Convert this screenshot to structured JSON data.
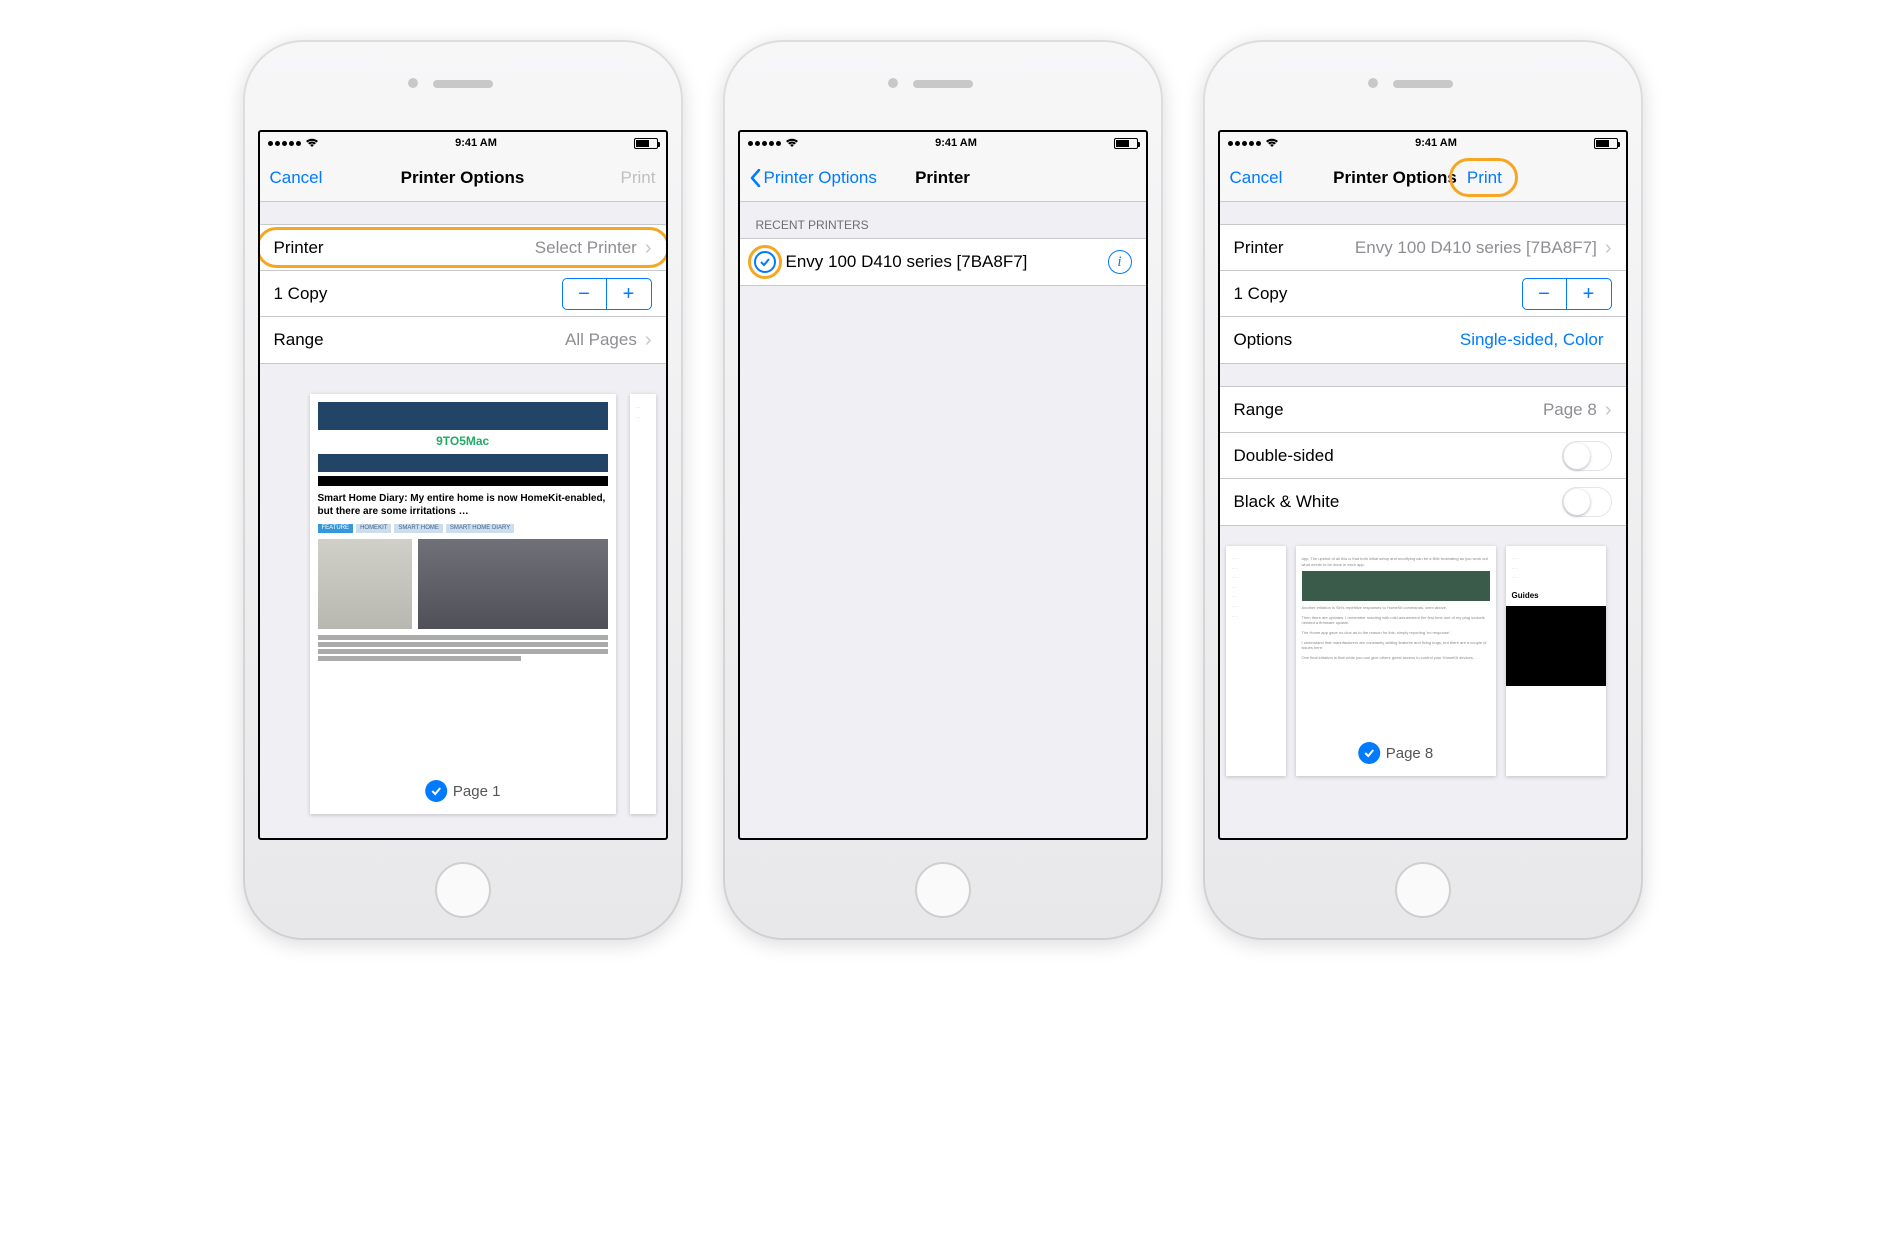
{
  "status_bar": {
    "time": "9:41 AM"
  },
  "colors": {
    "blue": "#007aff",
    "highlight": "#f5a623"
  },
  "phone1": {
    "nav": {
      "left": "Cancel",
      "title": "Printer Options",
      "right": "Print",
      "right_enabled": false
    },
    "rows": {
      "printer_label": "Printer",
      "printer_value": "Select Printer",
      "copies": "1 Copy",
      "range_label": "Range",
      "range_value": "All Pages"
    },
    "preview": {
      "page_label": "Page 1",
      "article_site": "9TO5Mac",
      "article_title": "Smart Home Diary: My entire home is now HomeKit-enabled, but there are some irritations …",
      "tags": [
        "FEATURE",
        "HOMEKIT",
        "SMART HOME",
        "SMART HOME DIARY"
      ]
    }
  },
  "phone2": {
    "nav": {
      "back": "Printer Options",
      "title": "Printer"
    },
    "section_header": "Recent Printers",
    "printer_name": "Envy 100 D410 series [7BA8F7]",
    "selected": true
  },
  "phone3": {
    "nav": {
      "left": "Cancel",
      "title": "Printer Options",
      "right": "Print",
      "right_enabled": true
    },
    "rows": {
      "printer_label": "Printer",
      "printer_value": "Envy 100 D410 series [7BA8F7]",
      "copies": "1 Copy",
      "options_label": "Options",
      "options_value": "Single-sided, Color",
      "range_label": "Range",
      "range_value": "Page 8",
      "double_sided": "Double-sided",
      "bw": "Black & White"
    },
    "preview": {
      "page_label": "Page 8",
      "guides_label": "Guides"
    }
  }
}
